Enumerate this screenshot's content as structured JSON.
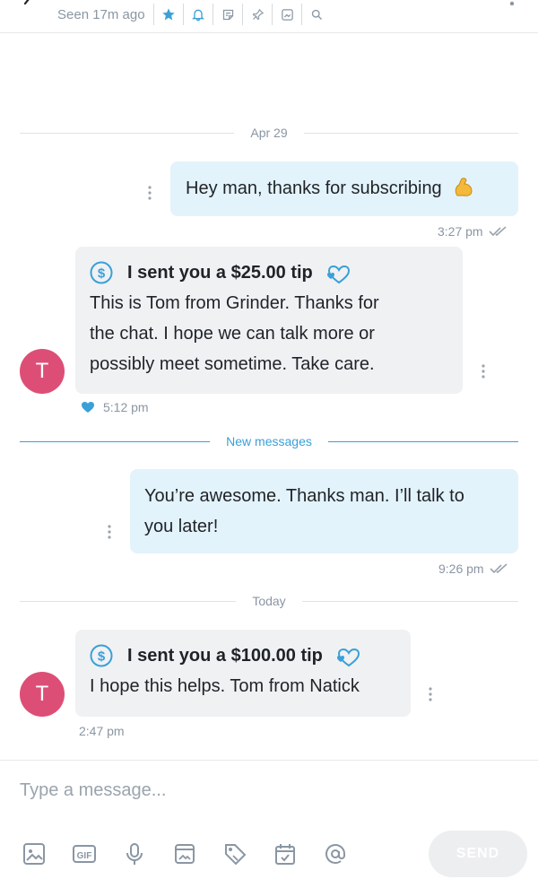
{
  "header": {
    "seen_text": "Seen 17m ago",
    "icons": [
      "star-icon",
      "bell-icon",
      "note-icon",
      "pin-icon",
      "image-icon",
      "search-icon"
    ],
    "accent_color": "#3aa0d8"
  },
  "separators": {
    "apr29": "Apr 29",
    "new_messages": "New messages",
    "today": "Today"
  },
  "messages": [
    {
      "direction": "out",
      "text": "Hey man, thanks for subscribing",
      "emoji": "flexed-biceps-icon",
      "time": "3:27 pm",
      "read": true
    },
    {
      "direction": "in",
      "avatar": "T",
      "tip": "I sent you a $25.00 tip",
      "text_lines": [
        "This is Tom from Grinder. Thanks for",
        "the chat. I hope we can talk more or",
        "possibly meet sometime. Take care."
      ],
      "time": "5:12 pm",
      "liked": true
    },
    {
      "direction": "out",
      "text_lines": [
        "You’re awesome. Thanks man. I’ll talk to",
        "you later!"
      ],
      "time": "9:26 pm",
      "read": true
    },
    {
      "direction": "in",
      "avatar": "T",
      "tip": "I sent you a $100.00 tip",
      "text_lines": [
        "I hope this helps. Tom from Natick"
      ],
      "time": "2:47 pm"
    }
  ],
  "composer": {
    "placeholder": "Type a message...",
    "send_label": "SEND",
    "tools": [
      "image-icon",
      "gif-icon",
      "microphone-icon",
      "media-vault-icon",
      "price-tag-icon",
      "schedule-icon",
      "mention-icon"
    ]
  },
  "colors": {
    "avatar": "#dd4e76",
    "outgoing_bubble": "#e3f3fb",
    "incoming_bubble": "#f0f1f3"
  }
}
